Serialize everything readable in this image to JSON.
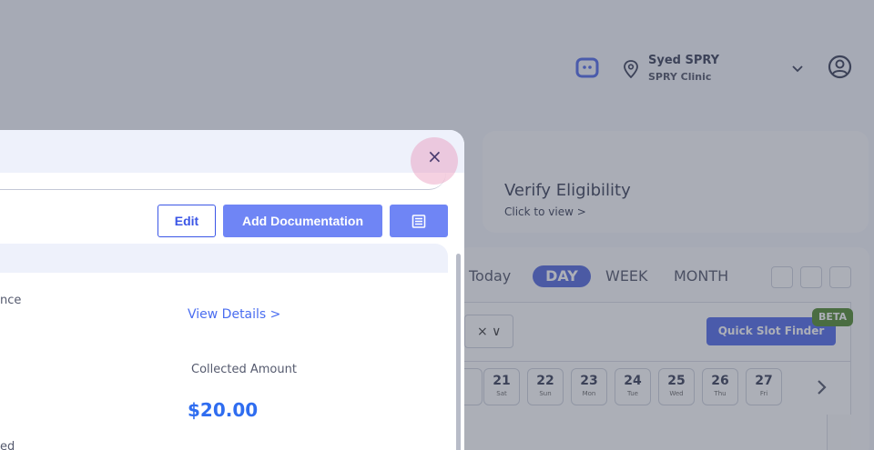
{
  "header": {
    "user_name": "Syed SPRY",
    "clinic_name": "SPRY Clinic"
  },
  "verify": {
    "title": "Verify Eligibility",
    "subtitle": "Click to view >"
  },
  "calendar": {
    "views": {
      "today": "Today",
      "day": "DAY",
      "week": "WEEK",
      "month": "MONTH"
    },
    "select_value": "× ∨",
    "quick_slot_label": "Quick Slot Finder",
    "beta_label": "BETA",
    "dates": [
      {
        "num": "21",
        "day": "Sat"
      },
      {
        "num": "22",
        "day": "Sun"
      },
      {
        "num": "23",
        "day": "Mon"
      },
      {
        "num": "24",
        "day": "Tue"
      },
      {
        "num": "25",
        "day": "Wed"
      },
      {
        "num": "26",
        "day": "Thu"
      },
      {
        "num": "27",
        "day": "Fri"
      }
    ]
  },
  "modal": {
    "close_label": "×",
    "edit_label": "Edit",
    "add_doc_label": "Add Documentation",
    "partial_label_1": "nce",
    "view_details": "View Details >",
    "collected_label": "Collected Amount",
    "collected_amount": "$20.00",
    "partial_label_2": "ed"
  },
  "colors": {
    "accent": "#3b56e6",
    "button_fill": "#6f85f5",
    "amount": "#2f6df0",
    "beta": "#3a7a12"
  }
}
